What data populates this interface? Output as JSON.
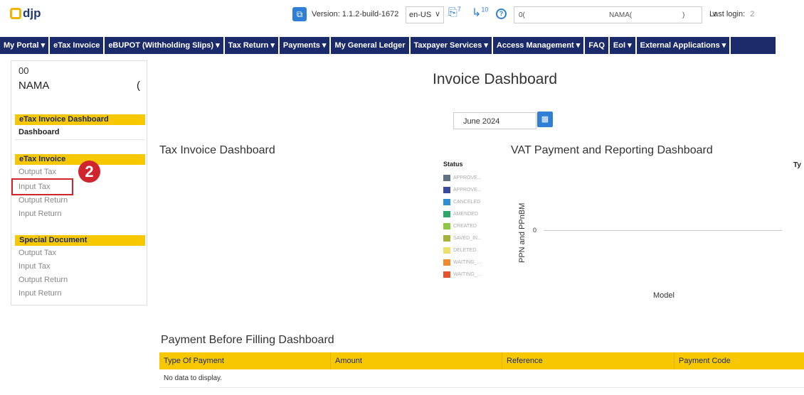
{
  "header": {
    "logo_text": "djp",
    "version": "Version: 1.1.2-build-1672",
    "language": "en-US",
    "doc_badge": "7",
    "notif_badge": "10",
    "help_icon": "?",
    "user_id_fragment": "0(",
    "user_name_fragment": "NAMA(",
    "user_tail_fragment": ")",
    "last_login_label": "Last login:",
    "last_login_value": "2"
  },
  "nav": {
    "items": [
      "My Portal ▾",
      "eTax Invoice",
      "eBUPOT (Withholding Slips) ▾",
      "Tax Return ▾",
      "Payments ▾",
      "My General Ledger",
      "Taxpayer Services ▾",
      "Access Management ▾",
      "FAQ",
      "EoI ▾",
      "External Applications ▾"
    ]
  },
  "sidebar": {
    "user_id": "00",
    "user_name": "NAMA",
    "user_tail": "(",
    "groups": [
      {
        "header": "eTax Invoice Dashboard",
        "links": [
          "Dashboard"
        ]
      },
      {
        "header": "eTax Invoice",
        "links": [
          "Output Tax",
          "Input Tax",
          "Output Return",
          "Input Return"
        ]
      },
      {
        "header": "Special Document",
        "links": [
          "Output Tax",
          "Input Tax",
          "Output Return",
          "Input Return"
        ]
      }
    ],
    "step_number": "2"
  },
  "main": {
    "title": "Invoice Dashboard",
    "month_value": "June 2024",
    "tax_invoice_title": "Tax Invoice Dashboard",
    "vat_title": "VAT Payment and Reporting Dashboard",
    "payment_title": "Payment Before Filling Dashboard",
    "ty_label": "Ty"
  },
  "status_legend": {
    "title": "Status",
    "items": [
      {
        "label": "APPROVE...",
        "color": "#5f7183"
      },
      {
        "label": "APPROVE...",
        "color": "#3a4aa0"
      },
      {
        "label": "CANCELED",
        "color": "#2f8fd6"
      },
      {
        "label": "AMENDED",
        "color": "#2aa86a"
      },
      {
        "label": "CREATED",
        "color": "#8fc744"
      },
      {
        "label": "SAVED_IN...",
        "color": "#a6b23a"
      },
      {
        "label": "DELETED",
        "color": "#ede06a"
      },
      {
        "label": "WAITING_...",
        "color": "#f08a2e"
      },
      {
        "label": "WAITING_...",
        "color": "#e8502b"
      }
    ]
  },
  "chart_data": {
    "type": "bar",
    "title": "VAT Payment and Reporting Dashboard",
    "xlabel": "Model",
    "ylabel": "PPN and PPnBM",
    "y_ticks": [
      "0"
    ],
    "categories": [],
    "values": []
  },
  "payment_table": {
    "columns": [
      "Type Of Payment",
      "Amount",
      "Reference",
      "Payment Code"
    ],
    "empty_text": "No data to display."
  },
  "colors": {
    "nav_bg": "#1b2a6b",
    "accent_yellow": "#f7c700",
    "primary_blue": "#2f7fd6",
    "highlight_red": "#d0252d"
  }
}
